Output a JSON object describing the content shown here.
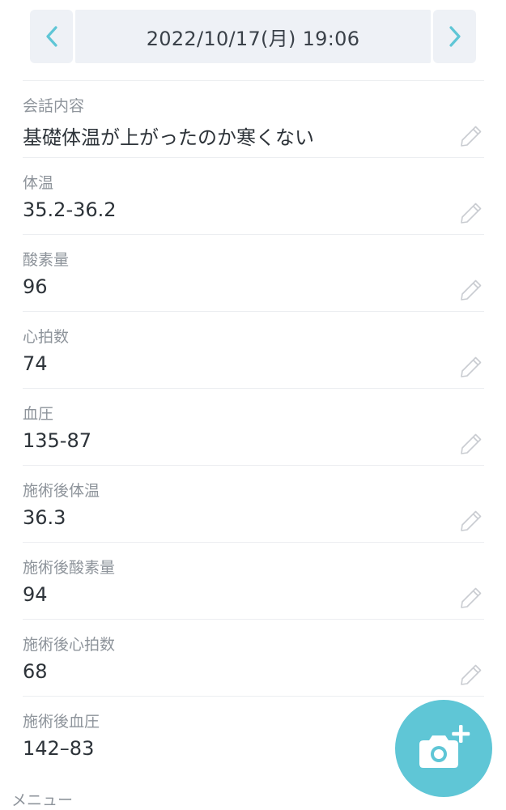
{
  "header": {
    "date_label": "2022/10/17(月) 19:06"
  },
  "fields": [
    {
      "label": "会話内容",
      "value": "基礎体温が上がったのか寒くない"
    },
    {
      "label": "体温",
      "value": "35.2-36.2"
    },
    {
      "label": "酸素量",
      "value": "96"
    },
    {
      "label": "心拍数",
      "value": "74"
    },
    {
      "label": "血圧",
      "value": "135-87"
    },
    {
      "label": "施術後体温",
      "value": "36.3"
    },
    {
      "label": "施術後酸素量",
      "value": "94"
    },
    {
      "label": "施術後心拍数",
      "value": "68"
    },
    {
      "label": "施術後血圧",
      "value": "142–83"
    }
  ],
  "menu": {
    "label": "メニュー"
  },
  "icons": {
    "prev": "chevron-left-icon",
    "next": "chevron-right-icon",
    "edit": "pencil-icon",
    "fab": "camera-plus-icon"
  },
  "colors": {
    "accent": "#5fc6d6",
    "nav_bg": "#eef1f6",
    "label": "#8e949b",
    "value": "#2d3339",
    "edit_icon": "#c9ccd1"
  }
}
